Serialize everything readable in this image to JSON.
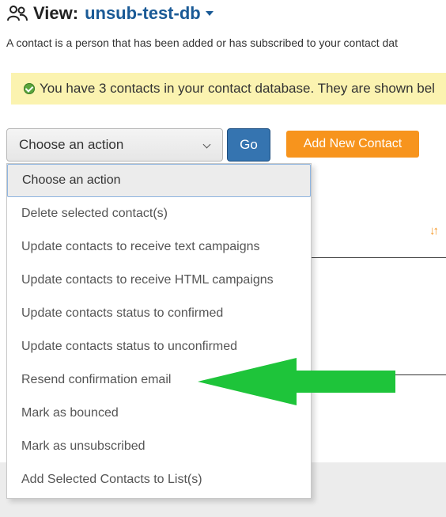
{
  "header": {
    "view_label": "View:",
    "database_name": "unsub-test-db"
  },
  "description": "A contact is a person that has been added or has subscribed to your contact dat",
  "alert": {
    "text": "You have 3 contacts in your contact database. They are shown bel"
  },
  "actions": {
    "selected": "Choose an action",
    "go_label": "Go",
    "add_contact_label": "Add New Contact",
    "options": [
      "Choose an action",
      "Delete selected contact(s)",
      "Update contacts to receive text campaigns",
      "Update contacts to receive HTML campaigns",
      "Update contacts status to confirmed",
      "Update contacts status to unconfirmed",
      "Resend confirmation email",
      "Mark as bounced",
      "Mark as unsubscribed",
      "Add Selected Contacts to List(s)"
    ]
  },
  "colors": {
    "brand_blue": "#1a5a96",
    "go_button": "#3574b0",
    "add_button": "#f7941d",
    "alert_bg": "#fbf3b0",
    "annotation_arrow": "#1ec43a"
  },
  "icons": {
    "header": "contacts-icon",
    "alert": "check-circle-icon",
    "sort": "sort-icon",
    "annotation": "left-arrow-annotation"
  }
}
